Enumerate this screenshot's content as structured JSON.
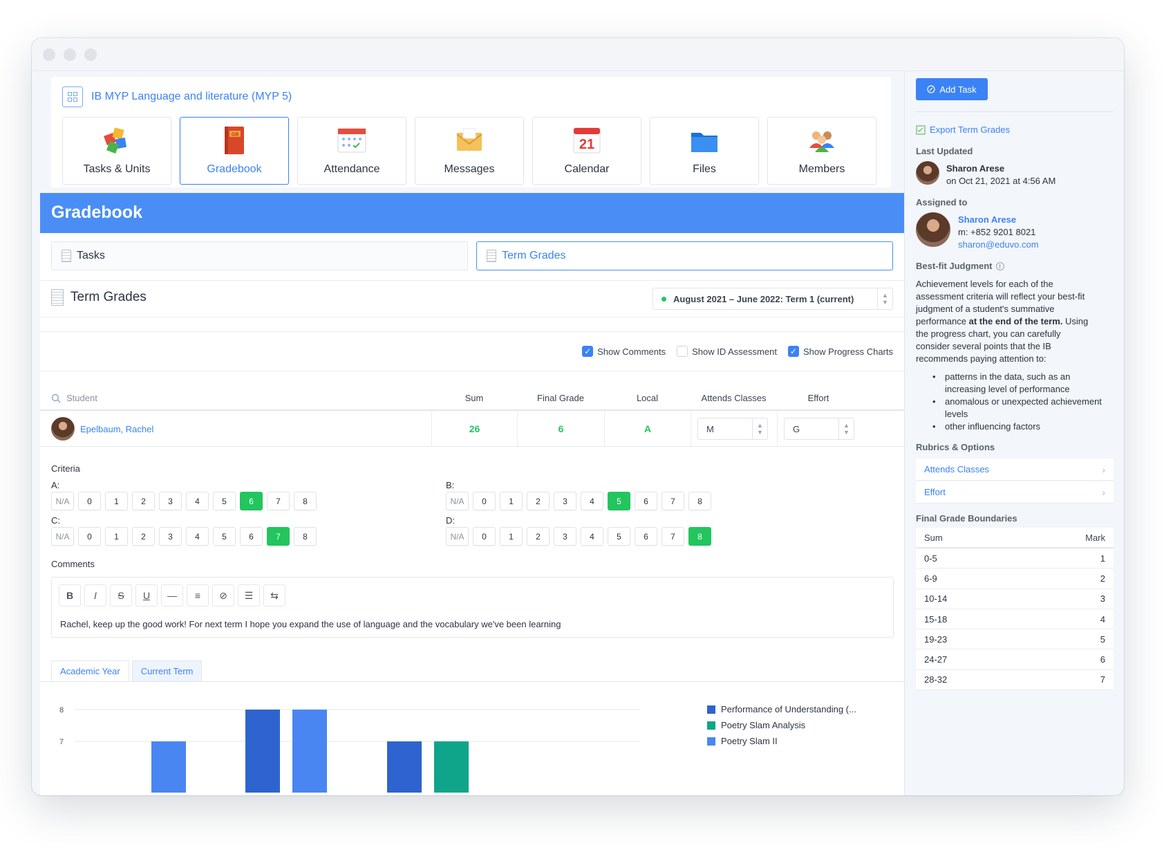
{
  "course": {
    "title": "IB MYP Language and literature (MYP 5)"
  },
  "apps": [
    {
      "label": "Tasks & Units",
      "icon": "puzzle-icon"
    },
    {
      "label": "Gradebook",
      "icon": "gradebook-book-icon",
      "icon_text": "GB"
    },
    {
      "label": "Attendance",
      "icon": "attendance-calendar-icon"
    },
    {
      "label": "Messages",
      "icon": "envelope-icon"
    },
    {
      "label": "Calendar",
      "icon": "calendar-icon",
      "icon_text": "21"
    },
    {
      "label": "Files",
      "icon": "folder-icon"
    },
    {
      "label": "Members",
      "icon": "members-icon"
    }
  ],
  "gradebook": {
    "title": "Gradebook"
  },
  "subtabs": {
    "tasks": "Tasks",
    "term_grades": "Term Grades"
  },
  "term": {
    "heading": "Term Grades",
    "selected": "August 2021 – June 2022: Term 1 (current)"
  },
  "options": {
    "show_comments": {
      "label": "Show Comments",
      "checked": true
    },
    "show_id_assessment": {
      "label": "Show ID Assessment",
      "checked": false
    },
    "show_progress_charts": {
      "label": "Show Progress Charts",
      "checked": true
    }
  },
  "table": {
    "search_placeholder": "Student",
    "columns": [
      "Sum",
      "Final Grade",
      "Local",
      "Attends Classes",
      "Effort"
    ],
    "row": {
      "student": "Epelbaum, Rachel",
      "sum": "26",
      "final_grade": "6",
      "local": "A",
      "attends": "M",
      "effort": "G"
    }
  },
  "criteria": {
    "label": "Criteria",
    "scale": [
      "N/A",
      "0",
      "1",
      "2",
      "3",
      "4",
      "5",
      "6",
      "7",
      "8"
    ],
    "items": [
      {
        "name": "A:",
        "selected": "6"
      },
      {
        "name": "B:",
        "selected": "5"
      },
      {
        "name": "C:",
        "selected": "7"
      },
      {
        "name": "D:",
        "selected": "8"
      }
    ]
  },
  "comments": {
    "label": "Comments",
    "toolbar": [
      "B",
      "I",
      "S",
      "U",
      "—",
      "≡",
      "⊘",
      "☰",
      "⇆"
    ],
    "text": "Rachel, keep up the good work! For next term I hope you expand the use of language and the vocabulary we've been learning"
  },
  "chart_tabs": {
    "academic_year": "Academic Year",
    "current_term": "Current Term"
  },
  "chart_data": {
    "type": "bar",
    "ylim": [
      6,
      8
    ],
    "yticks": [
      "8",
      "7"
    ],
    "series": [
      {
        "name": "Performance of Understanding (...",
        "color": "#2f63cf",
        "values": [
          null,
          8,
          null,
          7
        ]
      },
      {
        "name": "Poetry Slam Analysis",
        "color": "#0ea58a",
        "values": [
          null,
          null,
          null,
          7
        ]
      },
      {
        "name": "Poetry Slam II",
        "color": "#4a86f2",
        "values": [
          7,
          8,
          null,
          null
        ]
      }
    ],
    "bars": [
      {
        "series": 2,
        "value": 7
      },
      {
        "series": 0,
        "value": 8
      },
      {
        "series": 2,
        "value": 8
      },
      {
        "series": 0,
        "value": 7
      },
      {
        "series": 1,
        "value": 7
      }
    ]
  },
  "sidebar": {
    "add_task": "Add Task",
    "export": "Export Term Grades",
    "last_updated_label": "Last Updated",
    "last_updated_name": "Sharon Arese",
    "last_updated_date": "on Oct 21, 2021 at 4:56 AM",
    "assigned_label": "Assigned to",
    "assigned_name": "Sharon Arese",
    "assigned_phone": "m: +852 9201 8021",
    "assigned_email": "sharon@eduvo.com",
    "bestfit_label": "Best-fit Judgment",
    "bestfit_text_1": "Achievement levels for each of the",
    "bestfit_text_2": "assessment criteria will reflect your best-fit",
    "bestfit_text_3": "judgment of a student's summative",
    "bestfit_text_4a": "performance",
    "bestfit_text_4b": "at the end of the term.",
    "bestfit_text_4c": "Using",
    "bestfit_text_5": "the progress chart, you can carefully",
    "bestfit_text_6": "consider several points that the IB",
    "bestfit_text_7": "recommends paying attention to:",
    "bullets": [
      "patterns in the data, such as an increasing level of performance",
      "anomalous or unexpected achievement levels",
      "other influencing factors"
    ],
    "rubrics_label": "Rubrics & Options",
    "rubrics": [
      "Attends Classes",
      "Effort"
    ],
    "fgb_label": "Final Grade Boundaries",
    "fgb_head": {
      "sum": "Sum",
      "mark": "Mark"
    },
    "fgb_rows": [
      {
        "sum": "0-5",
        "mark": "1"
      },
      {
        "sum": "6-9",
        "mark": "2"
      },
      {
        "sum": "10-14",
        "mark": "3"
      },
      {
        "sum": "15-18",
        "mark": "4"
      },
      {
        "sum": "19-23",
        "mark": "5"
      },
      {
        "sum": "24-27",
        "mark": "6"
      },
      {
        "sum": "28-32",
        "mark": "7"
      }
    ]
  }
}
